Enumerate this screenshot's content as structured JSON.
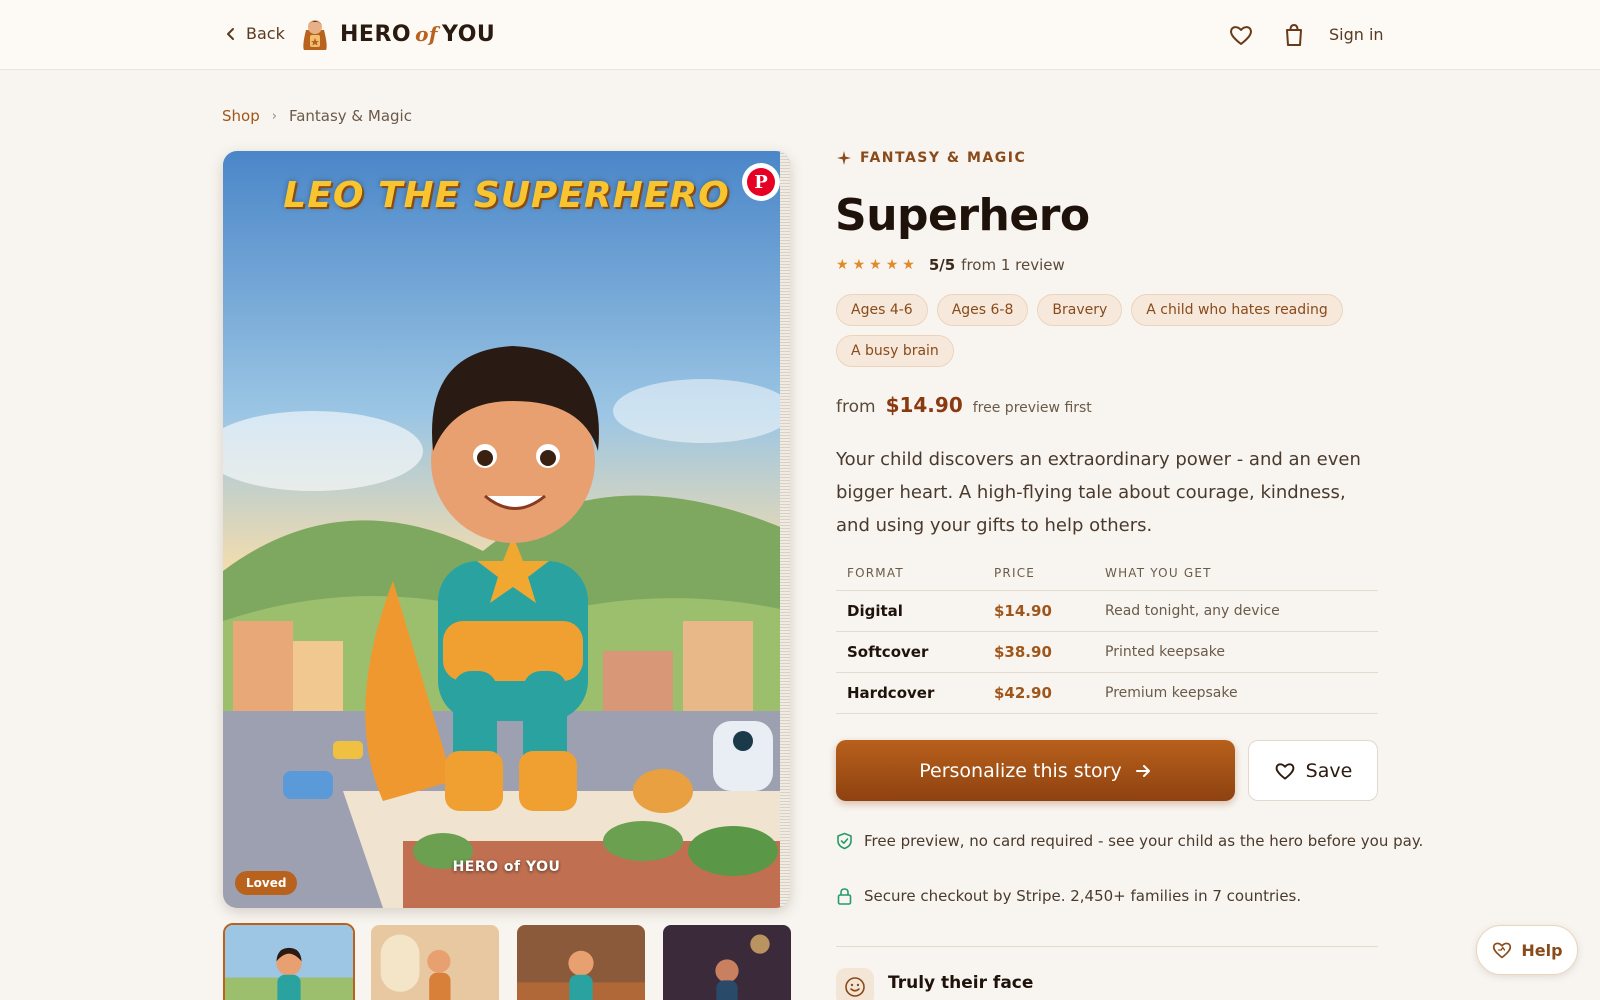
{
  "header": {
    "back_label": "Back",
    "logo_left": "HERO",
    "logo_of": "of",
    "logo_right": "YOU",
    "signin_label": "Sign in"
  },
  "breadcrumb": {
    "shop": "Shop",
    "current": "Fantasy & Magic"
  },
  "hero": {
    "book_title": "LEO THE SUPERHERO",
    "badge": "Loved",
    "watermark": "HERO of YOU",
    "pinterest": "P"
  },
  "product": {
    "category": "FANTASY & MAGIC",
    "title": "Superhero",
    "rating_score": "5/5",
    "rating_text": "from 1 review",
    "stars": 5,
    "tags": [
      "Ages 4-6",
      "Ages 6-8",
      "Bravery",
      "A child who hates reading",
      "A busy brain"
    ],
    "price_from": "from",
    "price": "$14.90",
    "price_note": "free preview first",
    "description": "Your child discovers an extraordinary power - and an even bigger heart. A high-flying tale about courage, kindness, and using your gifts to help others."
  },
  "pricing_table": {
    "headers": [
      "FORMAT",
      "PRICE",
      "WHAT YOU GET"
    ],
    "rows": [
      {
        "format": "Digital",
        "price": "$14.90",
        "what": "Read tonight, any device"
      },
      {
        "format": "Softcover",
        "price": "$38.90",
        "what": "Printed keepsake"
      },
      {
        "format": "Hardcover",
        "price": "$42.90",
        "what": "Premium keepsake"
      }
    ]
  },
  "actions": {
    "cta_label": "Personalize this story",
    "save_label": "Save"
  },
  "assurances": {
    "preview": "Free preview, no card required - see your child as the hero before you pay.",
    "secure": "Secure checkout by Stripe. 2,450+ families in 7 countries."
  },
  "feature": {
    "title": "Truly their face"
  },
  "help_label": "Help",
  "colors": {
    "accent": "#b8621e",
    "accent_dark": "#8e4210",
    "background": "#f8f5f0",
    "star": "#e08a28",
    "pinterest": "#e60023"
  },
  "icons": [
    "chevron-left-icon",
    "heart-icon",
    "shopping-bag-icon",
    "sparkle-icon",
    "star-icon",
    "arrow-right-icon",
    "shield-check-icon",
    "lock-icon",
    "smile-icon",
    "heart-help-icon"
  ]
}
